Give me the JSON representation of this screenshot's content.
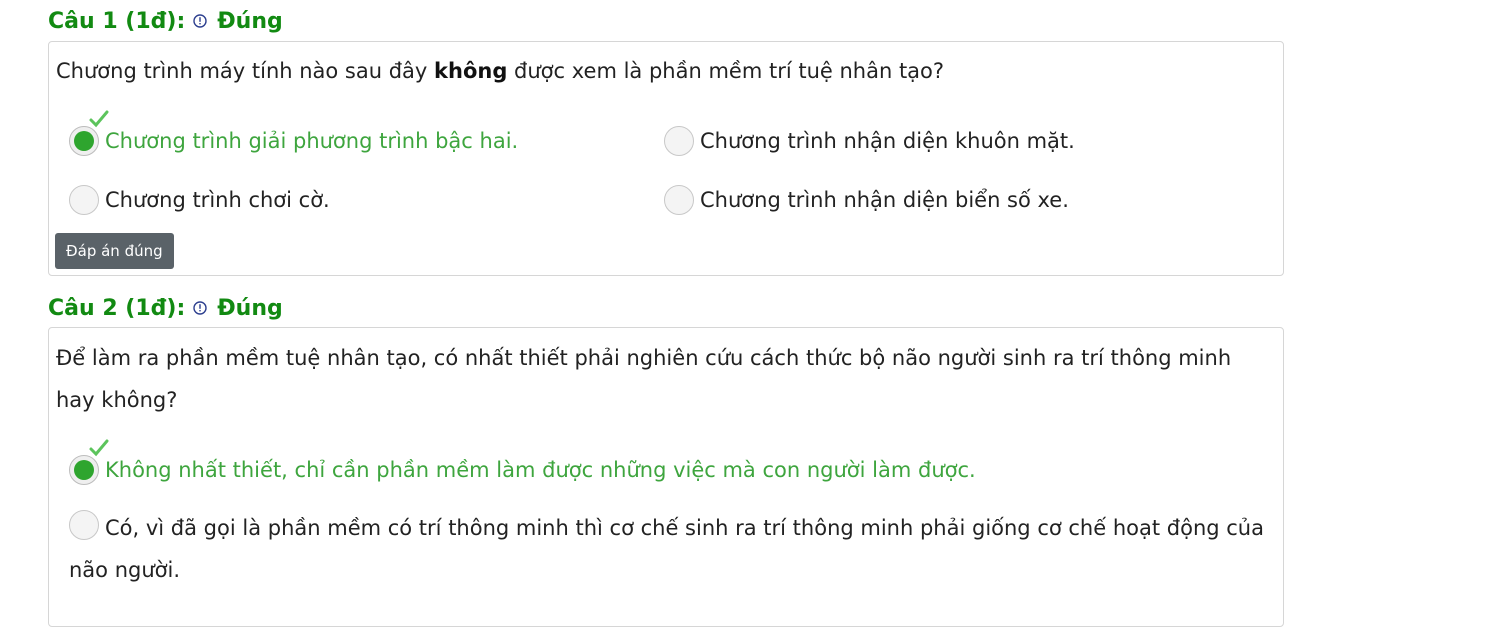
{
  "questions": [
    {
      "number_label": "Câu 1 (1đ):",
      "status": "Đúng",
      "text_before": "Chương trình máy tính nào sau đây ",
      "text_bold": "không",
      "text_after": " được xem là phần mềm trí tuệ nhân tạo?",
      "options": [
        {
          "label": "Chương trình giải phương trình bậc hai.",
          "selected": true,
          "correct": true
        },
        {
          "label": "Chương trình nhận diện khuôn mặt.",
          "selected": false,
          "correct": false
        },
        {
          "label": "Chương trình chơi cờ.",
          "selected": false,
          "correct": false
        },
        {
          "label": "Chương trình nhận diện biển số xe.",
          "selected": false,
          "correct": false
        }
      ],
      "button_label": "Đáp án đúng"
    },
    {
      "number_label": "Câu 2 (1đ):",
      "status": "Đúng",
      "text": "Để làm ra phần mềm tuệ nhân tạo, có nhất thiết phải nghiên cứu cách thức bộ não người sinh ra trí thông minh hay không?",
      "options": [
        {
          "label": "Không nhất thiết, chỉ cần phần mềm làm được những việc mà con người làm được.",
          "selected": true,
          "correct": true
        },
        {
          "label": "Có, vì đã gọi là phần mềm có trí thông minh thì cơ chế sinh ra trí thông minh phải giống cơ chế hoạt động của não người.",
          "selected": false,
          "correct": false
        }
      ]
    }
  ],
  "colors": {
    "header_green": "#128a12",
    "correct_text": "#3ea53e",
    "radio_fill": "#2ea52e",
    "button_bg": "#5a6268"
  },
  "icons": {
    "status_icon": "exclamation-circle-icon",
    "check_icon": "checkmark-icon"
  }
}
